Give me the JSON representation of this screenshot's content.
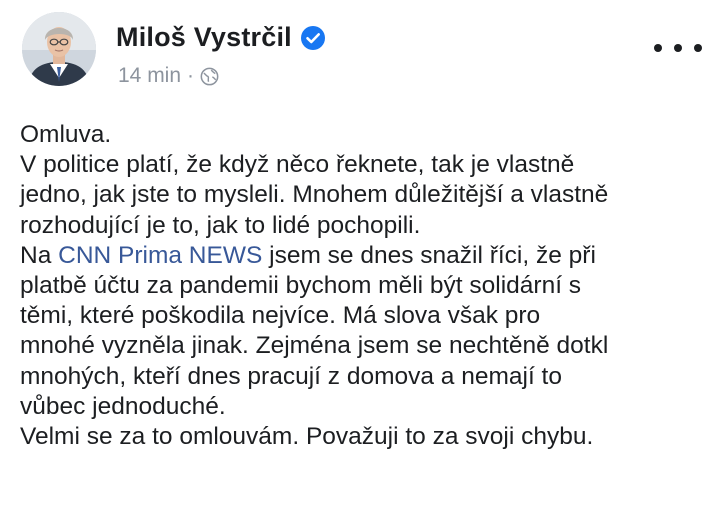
{
  "post": {
    "author": {
      "name": "Miloš Vystrčil",
      "verified": true,
      "avatar_icon": "profile-photo"
    },
    "meta": {
      "time": "14 min",
      "separator": "·",
      "privacy_icon": "globe-icon"
    },
    "menu_icon": "more-options-icon",
    "colors": {
      "text": "#1c1e21",
      "secondary": "#8d949e",
      "link": "#385898",
      "verified": "#1877f2"
    },
    "text": {
      "line1": "Omluva.",
      "line2": "V politice platí, že když něco řeknete, tak je vlastně",
      "line3": "jedno, jak jste to mysleli. Mnohem důležitější a vlastně",
      "line4": "rozhodující je to, jak to lidé pochopili.",
      "line5_prefix": "Na ",
      "line5_link": "CNN Prima NEWS",
      "line5_suffix": " jsem se dnes snažil říci, že při",
      "line6": "platbě účtu za pandemii bychom měli být solidární s",
      "line7": "těmi, které poškodila nejvíce. Má slova však pro",
      "line8": "mnohé vyzněla jinak. Zejména jsem se nechtěně dotkl",
      "line9": "mnohých, kteří dnes pracují z domova a nemají to",
      "line10": "vůbec jednoduché.",
      "line11": "Velmi se za to omlouvám. Považuji to za svoji chybu."
    }
  }
}
